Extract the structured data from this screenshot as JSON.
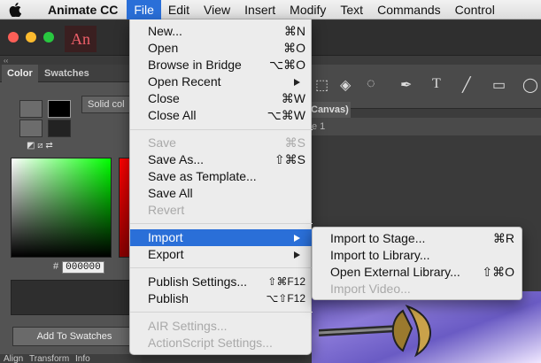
{
  "menubar": {
    "app_name": "Animate CC",
    "items": [
      "File",
      "Edit",
      "View",
      "Insert",
      "Modify",
      "Text",
      "Commands",
      "Control"
    ],
    "active": "File"
  },
  "app": {
    "logo_text": "An",
    "panel": {
      "tabs": [
        "Color",
        "Swatches"
      ],
      "fill_type": "Solid col",
      "hex_label": "#",
      "hex_value": "000000",
      "add_button": "Add To Swatches",
      "bottom_tabs": [
        "Align",
        "Transform",
        "Info"
      ]
    },
    "document_tab": "Canvas)",
    "scene_label": "e 1"
  },
  "file_menu": {
    "items": [
      {
        "label": "New...",
        "shortcut": "⌘N",
        "disabled": false
      },
      {
        "label": "Open",
        "shortcut": "⌘O",
        "disabled": false
      },
      {
        "label": "Browse in Bridge",
        "shortcut": "⌥⌘O",
        "disabled": false
      },
      {
        "label": "Open Recent",
        "shortcut": "",
        "disabled": false,
        "submenu": true
      },
      {
        "label": "Close",
        "shortcut": "⌘W",
        "disabled": false
      },
      {
        "label": "Close All",
        "shortcut": "⌥⌘W",
        "disabled": false
      },
      {
        "label": "Save",
        "shortcut": "⌘S",
        "disabled": true
      },
      {
        "label": "Save As...",
        "shortcut": "⇧⌘S",
        "disabled": false
      },
      {
        "label": "Save as Template...",
        "shortcut": "",
        "disabled": false
      },
      {
        "label": "Save All",
        "shortcut": "",
        "disabled": false
      },
      {
        "label": "Revert",
        "shortcut": "",
        "disabled": true
      },
      {
        "label": "Import",
        "shortcut": "",
        "disabled": false,
        "submenu": true,
        "highlighted": true
      },
      {
        "label": "Export",
        "shortcut": "",
        "disabled": false,
        "submenu": true
      },
      {
        "label": "Publish Settings...",
        "shortcut": "⇧⌘F12",
        "disabled": false
      },
      {
        "label": "Publish",
        "shortcut": "⌥⇧F12",
        "disabled": false
      },
      {
        "label": "AIR Settings...",
        "shortcut": "",
        "disabled": true
      },
      {
        "label": "ActionScript Settings...",
        "shortcut": "",
        "disabled": true
      }
    ]
  },
  "import_submenu": {
    "items": [
      {
        "label": "Import to Stage...",
        "shortcut": "⌘R",
        "disabled": false
      },
      {
        "label": "Import to Library...",
        "shortcut": "",
        "disabled": false
      },
      {
        "label": "Open External Library...",
        "shortcut": "⇧⌘O",
        "disabled": false
      },
      {
        "label": "Import Video...",
        "shortcut": "",
        "disabled": true
      }
    ]
  },
  "colors": {
    "highlight": "#2a6fd8",
    "menu_bg": "#ececec",
    "disabled_text": "#a9a9a9"
  }
}
